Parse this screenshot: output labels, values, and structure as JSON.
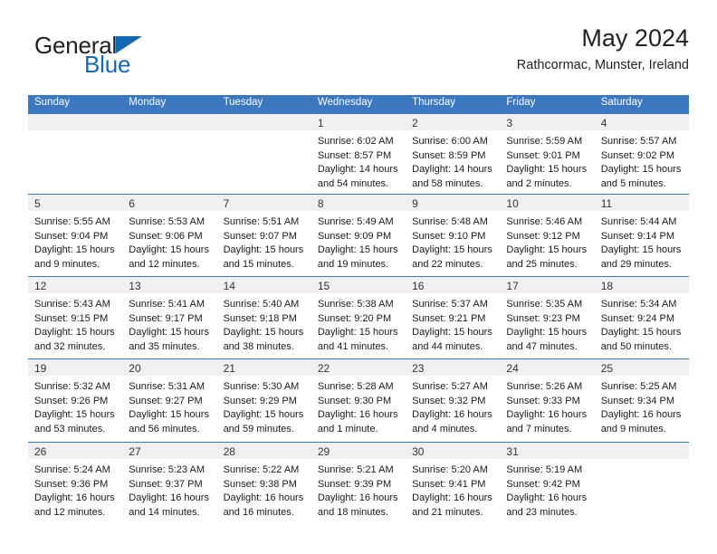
{
  "brand": {
    "name_top": "General",
    "name_bottom": "Blue",
    "triangle_icon": "triangle-icon",
    "color_dark": "#231f20",
    "color_blue": "#1368b3"
  },
  "header": {
    "title": "May 2024",
    "subtitle": "Rathcormac, Munster, Ireland"
  },
  "theme": {
    "header_bar": "#3b78bf",
    "day_band": "#f0f0f0",
    "row_divider": "#3b78bf"
  },
  "weekdays": [
    "Sunday",
    "Monday",
    "Tuesday",
    "Wednesday",
    "Thursday",
    "Friday",
    "Saturday"
  ],
  "weeks": [
    [
      {
        "empty": true
      },
      {
        "empty": true
      },
      {
        "empty": true
      },
      {
        "day": "1",
        "sunrise": "Sunrise: 6:02 AM",
        "sunset": "Sunset: 8:57 PM",
        "daylight": "Daylight: 14 hours and 54 minutes."
      },
      {
        "day": "2",
        "sunrise": "Sunrise: 6:00 AM",
        "sunset": "Sunset: 8:59 PM",
        "daylight": "Daylight: 14 hours and 58 minutes."
      },
      {
        "day": "3",
        "sunrise": "Sunrise: 5:59 AM",
        "sunset": "Sunset: 9:01 PM",
        "daylight": "Daylight: 15 hours and 2 minutes."
      },
      {
        "day": "4",
        "sunrise": "Sunrise: 5:57 AM",
        "sunset": "Sunset: 9:02 PM",
        "daylight": "Daylight: 15 hours and 5 minutes."
      }
    ],
    [
      {
        "day": "5",
        "sunrise": "Sunrise: 5:55 AM",
        "sunset": "Sunset: 9:04 PM",
        "daylight": "Daylight: 15 hours and 9 minutes."
      },
      {
        "day": "6",
        "sunrise": "Sunrise: 5:53 AM",
        "sunset": "Sunset: 9:06 PM",
        "daylight": "Daylight: 15 hours and 12 minutes."
      },
      {
        "day": "7",
        "sunrise": "Sunrise: 5:51 AM",
        "sunset": "Sunset: 9:07 PM",
        "daylight": "Daylight: 15 hours and 15 minutes."
      },
      {
        "day": "8",
        "sunrise": "Sunrise: 5:49 AM",
        "sunset": "Sunset: 9:09 PM",
        "daylight": "Daylight: 15 hours and 19 minutes."
      },
      {
        "day": "9",
        "sunrise": "Sunrise: 5:48 AM",
        "sunset": "Sunset: 9:10 PM",
        "daylight": "Daylight: 15 hours and 22 minutes."
      },
      {
        "day": "10",
        "sunrise": "Sunrise: 5:46 AM",
        "sunset": "Sunset: 9:12 PM",
        "daylight": "Daylight: 15 hours and 25 minutes."
      },
      {
        "day": "11",
        "sunrise": "Sunrise: 5:44 AM",
        "sunset": "Sunset: 9:14 PM",
        "daylight": "Daylight: 15 hours and 29 minutes."
      }
    ],
    [
      {
        "day": "12",
        "sunrise": "Sunrise: 5:43 AM",
        "sunset": "Sunset: 9:15 PM",
        "daylight": "Daylight: 15 hours and 32 minutes."
      },
      {
        "day": "13",
        "sunrise": "Sunrise: 5:41 AM",
        "sunset": "Sunset: 9:17 PM",
        "daylight": "Daylight: 15 hours and 35 minutes."
      },
      {
        "day": "14",
        "sunrise": "Sunrise: 5:40 AM",
        "sunset": "Sunset: 9:18 PM",
        "daylight": "Daylight: 15 hours and 38 minutes."
      },
      {
        "day": "15",
        "sunrise": "Sunrise: 5:38 AM",
        "sunset": "Sunset: 9:20 PM",
        "daylight": "Daylight: 15 hours and 41 minutes."
      },
      {
        "day": "16",
        "sunrise": "Sunrise: 5:37 AM",
        "sunset": "Sunset: 9:21 PM",
        "daylight": "Daylight: 15 hours and 44 minutes."
      },
      {
        "day": "17",
        "sunrise": "Sunrise: 5:35 AM",
        "sunset": "Sunset: 9:23 PM",
        "daylight": "Daylight: 15 hours and 47 minutes."
      },
      {
        "day": "18",
        "sunrise": "Sunrise: 5:34 AM",
        "sunset": "Sunset: 9:24 PM",
        "daylight": "Daylight: 15 hours and 50 minutes."
      }
    ],
    [
      {
        "day": "19",
        "sunrise": "Sunrise: 5:32 AM",
        "sunset": "Sunset: 9:26 PM",
        "daylight": "Daylight: 15 hours and 53 minutes."
      },
      {
        "day": "20",
        "sunrise": "Sunrise: 5:31 AM",
        "sunset": "Sunset: 9:27 PM",
        "daylight": "Daylight: 15 hours and 56 minutes."
      },
      {
        "day": "21",
        "sunrise": "Sunrise: 5:30 AM",
        "sunset": "Sunset: 9:29 PM",
        "daylight": "Daylight: 15 hours and 59 minutes."
      },
      {
        "day": "22",
        "sunrise": "Sunrise: 5:28 AM",
        "sunset": "Sunset: 9:30 PM",
        "daylight": "Daylight: 16 hours and 1 minute."
      },
      {
        "day": "23",
        "sunrise": "Sunrise: 5:27 AM",
        "sunset": "Sunset: 9:32 PM",
        "daylight": "Daylight: 16 hours and 4 minutes."
      },
      {
        "day": "24",
        "sunrise": "Sunrise: 5:26 AM",
        "sunset": "Sunset: 9:33 PM",
        "daylight": "Daylight: 16 hours and 7 minutes."
      },
      {
        "day": "25",
        "sunrise": "Sunrise: 5:25 AM",
        "sunset": "Sunset: 9:34 PM",
        "daylight": "Daylight: 16 hours and 9 minutes."
      }
    ],
    [
      {
        "day": "26",
        "sunrise": "Sunrise: 5:24 AM",
        "sunset": "Sunset: 9:36 PM",
        "daylight": "Daylight: 16 hours and 12 minutes."
      },
      {
        "day": "27",
        "sunrise": "Sunrise: 5:23 AM",
        "sunset": "Sunset: 9:37 PM",
        "daylight": "Daylight: 16 hours and 14 minutes."
      },
      {
        "day": "28",
        "sunrise": "Sunrise: 5:22 AM",
        "sunset": "Sunset: 9:38 PM",
        "daylight": "Daylight: 16 hours and 16 minutes."
      },
      {
        "day": "29",
        "sunrise": "Sunrise: 5:21 AM",
        "sunset": "Sunset: 9:39 PM",
        "daylight": "Daylight: 16 hours and 18 minutes."
      },
      {
        "day": "30",
        "sunrise": "Sunrise: 5:20 AM",
        "sunset": "Sunset: 9:41 PM",
        "daylight": "Daylight: 16 hours and 21 minutes."
      },
      {
        "day": "31",
        "sunrise": "Sunrise: 5:19 AM",
        "sunset": "Sunset: 9:42 PM",
        "daylight": "Daylight: 16 hours and 23 minutes."
      },
      {
        "empty": true
      }
    ]
  ]
}
